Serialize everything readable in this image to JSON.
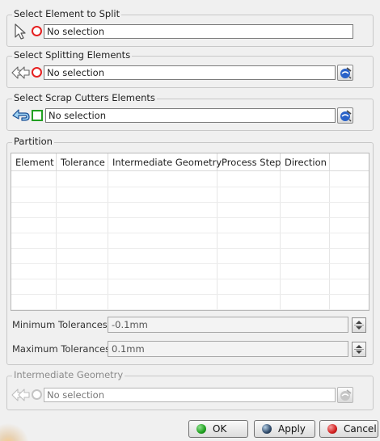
{
  "element_to_split": {
    "legend": "Select Element to Split",
    "value": "No selection",
    "icons": [
      "pointer-arrow-icon",
      "red-circle-icon"
    ]
  },
  "splitting_elements": {
    "legend": "Select Splitting Elements",
    "value": "No selection",
    "icons": [
      "double-arrow-icon",
      "red-circle-icon",
      "list-edit-icon"
    ]
  },
  "scrap_cutters": {
    "legend": "Select Scrap Cutters Elements",
    "value": "No selection",
    "icons": [
      "blue-curved-arrow-icon",
      "green-square-icon",
      "list-edit-icon"
    ]
  },
  "partition": {
    "legend": "Partition",
    "columns": [
      "Element",
      "Tolerance",
      "Intermediate Geometry",
      "Process Step",
      "Direction"
    ],
    "rows": []
  },
  "tolerances": {
    "minimum_label": "Minimum Tolerances",
    "minimum_value": "-0.1mm",
    "maximum_label": "Maximum Tolerances",
    "maximum_value": "0.1mm"
  },
  "intermediate_geometry": {
    "legend": "Intermediate Geometry",
    "value": "No selection",
    "enabled": false
  },
  "buttons": {
    "ok": "OK",
    "apply": "Apply",
    "cancel": "Cancel"
  },
  "colors": {
    "ok_dot": "#1fa11f",
    "apply_dot": "#2f4a6a",
    "cancel_dot": "#d42020",
    "required_marker": "#e52020",
    "scrap_marker": "#22a022"
  }
}
